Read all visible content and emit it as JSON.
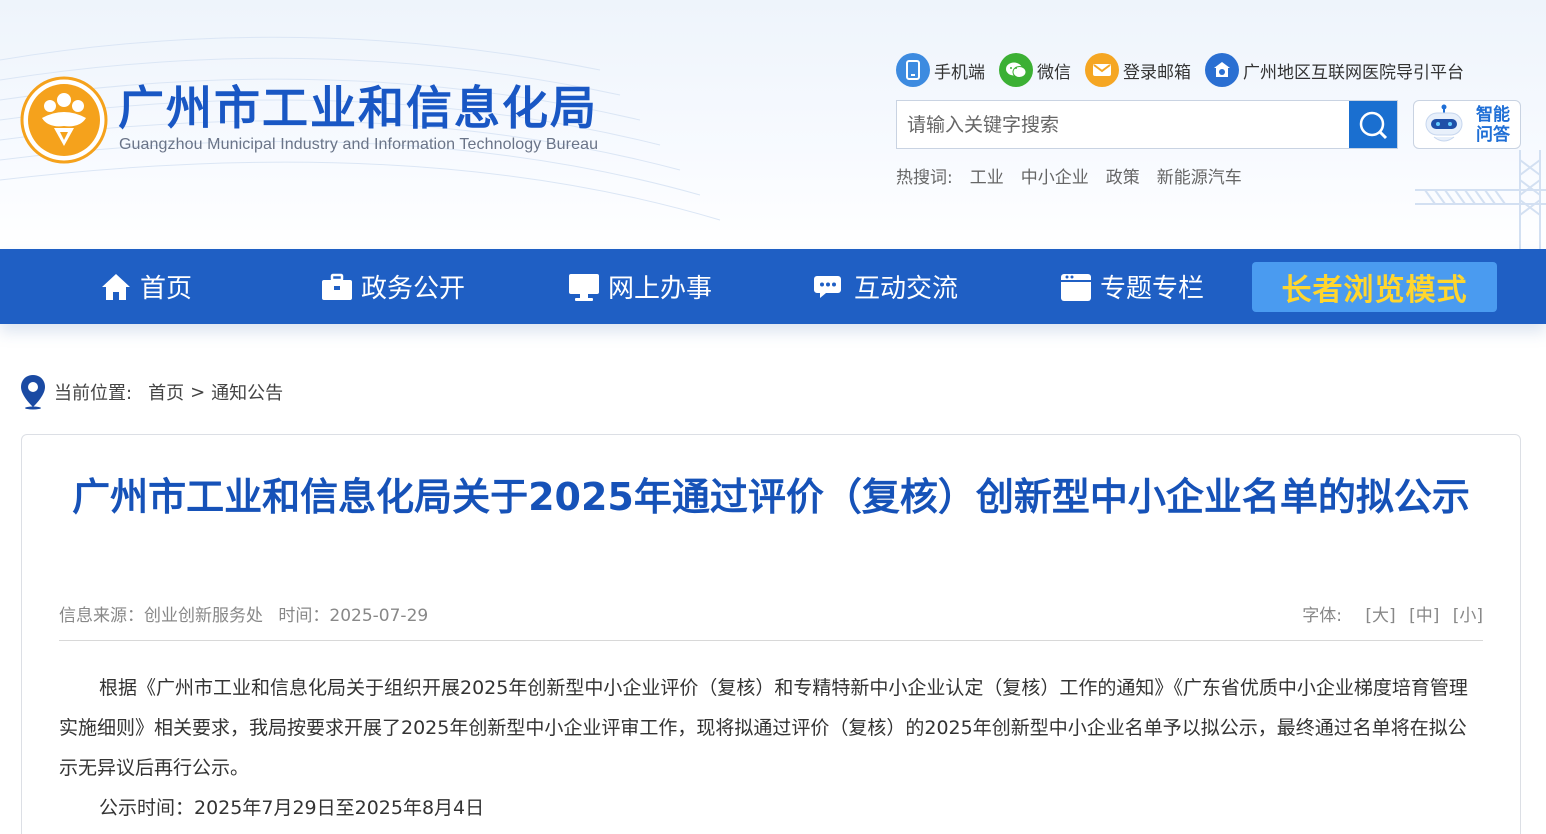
{
  "site": {
    "title": "广州市工业和信息化局",
    "subtitle": "Guangzhou Municipal Industry and Information Technology Bureau"
  },
  "toplinks": [
    {
      "label": "手机端",
      "icon": "mobile-icon",
      "color": "#3d8be0"
    },
    {
      "label": "微信",
      "icon": "wechat-icon",
      "color": "#3cb034"
    },
    {
      "label": "登录邮箱",
      "icon": "mail-icon",
      "color": "#f5a623"
    },
    {
      "label": "广州地区互联网医院导引平台",
      "icon": "hospital-icon",
      "color": "#2a6fd2"
    }
  ],
  "search": {
    "placeholder": "请输入关键字搜索"
  },
  "ai_assistant": {
    "label_line1": "智能",
    "label_line2": "问答"
  },
  "hot": {
    "label": "热搜词:",
    "words": [
      "工业",
      "中小企业",
      "政策",
      "新能源汽车"
    ]
  },
  "nav": {
    "items": [
      {
        "label": "首页",
        "icon": "home-icon"
      },
      {
        "label": "政务公开",
        "icon": "briefcase-icon"
      },
      {
        "label": "网上办事",
        "icon": "monitor-icon"
      },
      {
        "label": "互动交流",
        "icon": "chat-icon"
      },
      {
        "label": "专题专栏",
        "icon": "calendar-icon"
      }
    ],
    "elder_mode": "长者浏览模式"
  },
  "breadcrumb": {
    "label": "当前位置:",
    "items": [
      "首页",
      "通知公告"
    ],
    "separator": ">"
  },
  "article": {
    "title": "广州市工业和信息化局关于2025年通过评价（复核）创新型中小企业名单的拟公示",
    "source": "信息来源：创业创新服务处",
    "time": "时间：2025-07-29",
    "font_label": "字体:",
    "font_sizes": [
      "[大]",
      "[中]",
      "[小]"
    ],
    "paragraph1": "根据《广州市工业和信息化局关于组织开展2025年创新型中小企业评价（复核）和专精特新中小企业认定（复核）工作的通知》《广东省优质中小企业梯度培育管理实施细则》相关要求，我局按要求开展了2025年创新型中小企业评审工作，现将拟通过评价（复核）的2025年创新型中小企业名单予以拟公示，最终通过名单将在拟公示无异议后再行公示。",
    "paragraph2": "公示时间：2025年7月29日至2025年8月4日"
  },
  "colors": {
    "brand_blue": "#1f5fc4",
    "title_blue": "#1652b8",
    "elder_text": "#ffd62e",
    "logo_orange": "#f5a21c"
  }
}
